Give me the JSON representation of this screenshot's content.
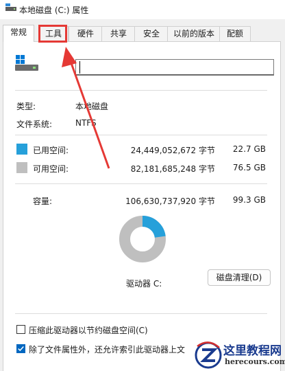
{
  "window": {
    "title": "本地磁盘 (C:) 属性"
  },
  "tabs": [
    {
      "label": "常规",
      "active": true
    },
    {
      "label": "工具",
      "active": false
    },
    {
      "label": "硬件",
      "active": false
    },
    {
      "label": "共享",
      "active": false
    },
    {
      "label": "安全",
      "active": false
    },
    {
      "label": "以前的版本",
      "active": false
    },
    {
      "label": "配额",
      "active": false
    }
  ],
  "general": {
    "name_value": "",
    "type_label": "类型:",
    "type_value": "本地磁盘",
    "fs_label": "文件系统:",
    "fs_value": "NTFS",
    "used_label": "已用空间:",
    "used_bytes": "24,449,052,672 字节",
    "used_size": "22.7 GB",
    "free_label": "可用空间:",
    "free_bytes": "82,181,685,248 字节",
    "free_size": "76.5 GB",
    "capacity_label": "容量:",
    "capacity_bytes": "106,630,737,920 字节",
    "capacity_size": "99.3 GB",
    "drive_label": "驱动器 C:",
    "cleanup_button": "磁盘清理(D)",
    "compress_label": "压缩此驱动器以节约磁盘空间(C)",
    "compress_checked": false,
    "index_label": "除了文件属性外，还允许索引此驱动器上文",
    "index_checked": true,
    "used_fraction": 0.229
  },
  "colors": {
    "used": "#26a0da",
    "free": "#bfbfbf",
    "highlight": "#e53935"
  },
  "watermark": {
    "title": "这里教程网",
    "url": "herecours.com"
  }
}
